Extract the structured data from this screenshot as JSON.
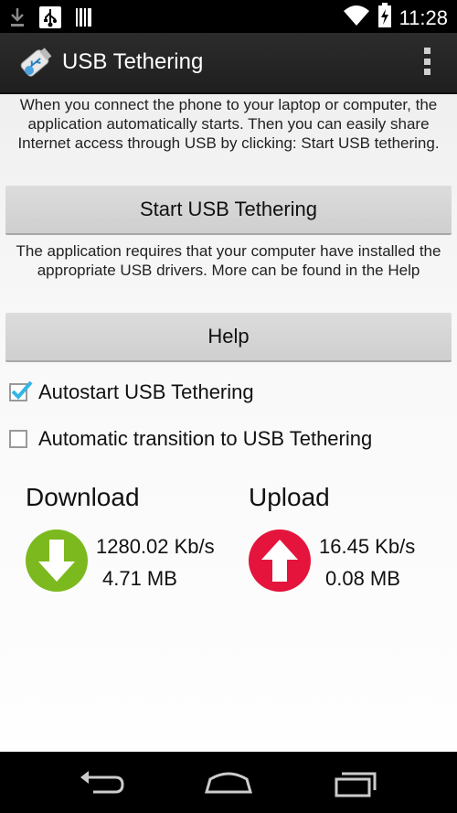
{
  "status_bar": {
    "time": "11:28",
    "icons": [
      "download-icon",
      "usb-icon",
      "barcode-icon",
      "wifi-icon",
      "battery-charging-icon"
    ]
  },
  "action_bar": {
    "title": "USB Tethering",
    "app_icon": "usb-tether-app-icon",
    "menu_icon": "overflow-menu-icon"
  },
  "main": {
    "description_start": "When you connect the phone to your laptop or computer, the application automatically starts. Then you can easily share Internet access through USB by clicking: Start USB tethering.",
    "start_button_label": "Start USB Tethering",
    "description_drivers": "The application requires that your computer have installed the appropriate USB drivers. More can be found in the Help",
    "help_button_label": "Help",
    "autostart": {
      "label": "Autostart USB Tethering",
      "checked": true
    },
    "auto_transition": {
      "label": "Automatic transition to USB Tethering",
      "checked": false
    }
  },
  "stats": {
    "download": {
      "title": "Download",
      "speed": "1280.02 Kb/s",
      "size": "4.71 MB",
      "color": "#7cb91e",
      "icon": "download-arrow-icon"
    },
    "upload": {
      "title": "Upload",
      "speed": "16.45 Kb/s",
      "size": "0.08 MB",
      "color": "#e4143c",
      "icon": "upload-arrow-icon"
    }
  },
  "nav_bar": {
    "icons": [
      "back-icon",
      "home-icon",
      "recents-icon"
    ]
  },
  "colors": {
    "accent_check": "#33b5e5",
    "action_bar": "#242424",
    "button": "#d6d6d6"
  }
}
